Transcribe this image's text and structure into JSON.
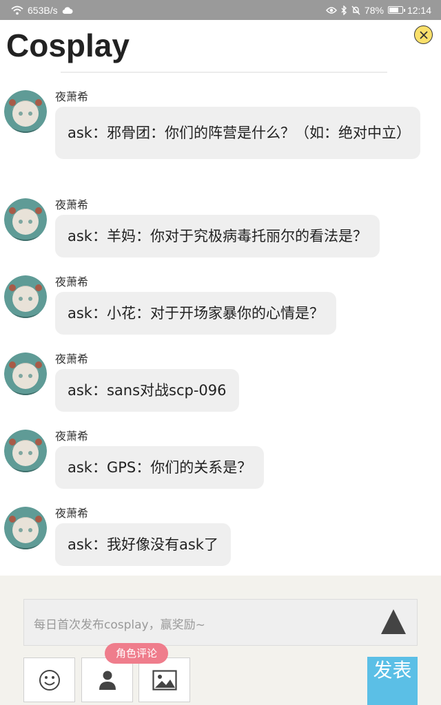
{
  "status_bar": {
    "speed": "653B/s",
    "battery": "78%",
    "battery_level": 0.78,
    "time": "12:14"
  },
  "header": {
    "title": "Cosplay"
  },
  "messages": [
    {
      "sender": "夜萧希",
      "text": "ask：邪骨团：你们的阵营是什么？（如：绝对中立）"
    },
    {
      "sender": "夜萧希",
      "text": "ask：羊妈：你对于究极病毒托丽尔的看法是？"
    },
    {
      "sender": "夜萧希",
      "text": "ask：小花：对于开场家暴你的心情是？"
    },
    {
      "sender": "夜萧希",
      "text": "ask：sans对战scp-096"
    },
    {
      "sender": "夜萧希",
      "text": "ask：GPS：你们的关系是？"
    },
    {
      "sender": "夜萧希",
      "text": "ask：我好像没有ask了"
    }
  ],
  "composer": {
    "placeholder": "每日首次发布cosplay，赢奖励~",
    "role_tag": "角色评论",
    "send_label": "发表"
  },
  "colors": {
    "accent_yellow": "#fae06b",
    "tag_pink": "#ef7d8c",
    "send_blue": "#5bbfe6",
    "bubble_bg": "#efefef"
  },
  "icons": {
    "close": "close-icon",
    "emoji": "emoji-icon",
    "person": "person-icon",
    "image": "image-icon",
    "send_arrow": "up-arrow-icon"
  }
}
